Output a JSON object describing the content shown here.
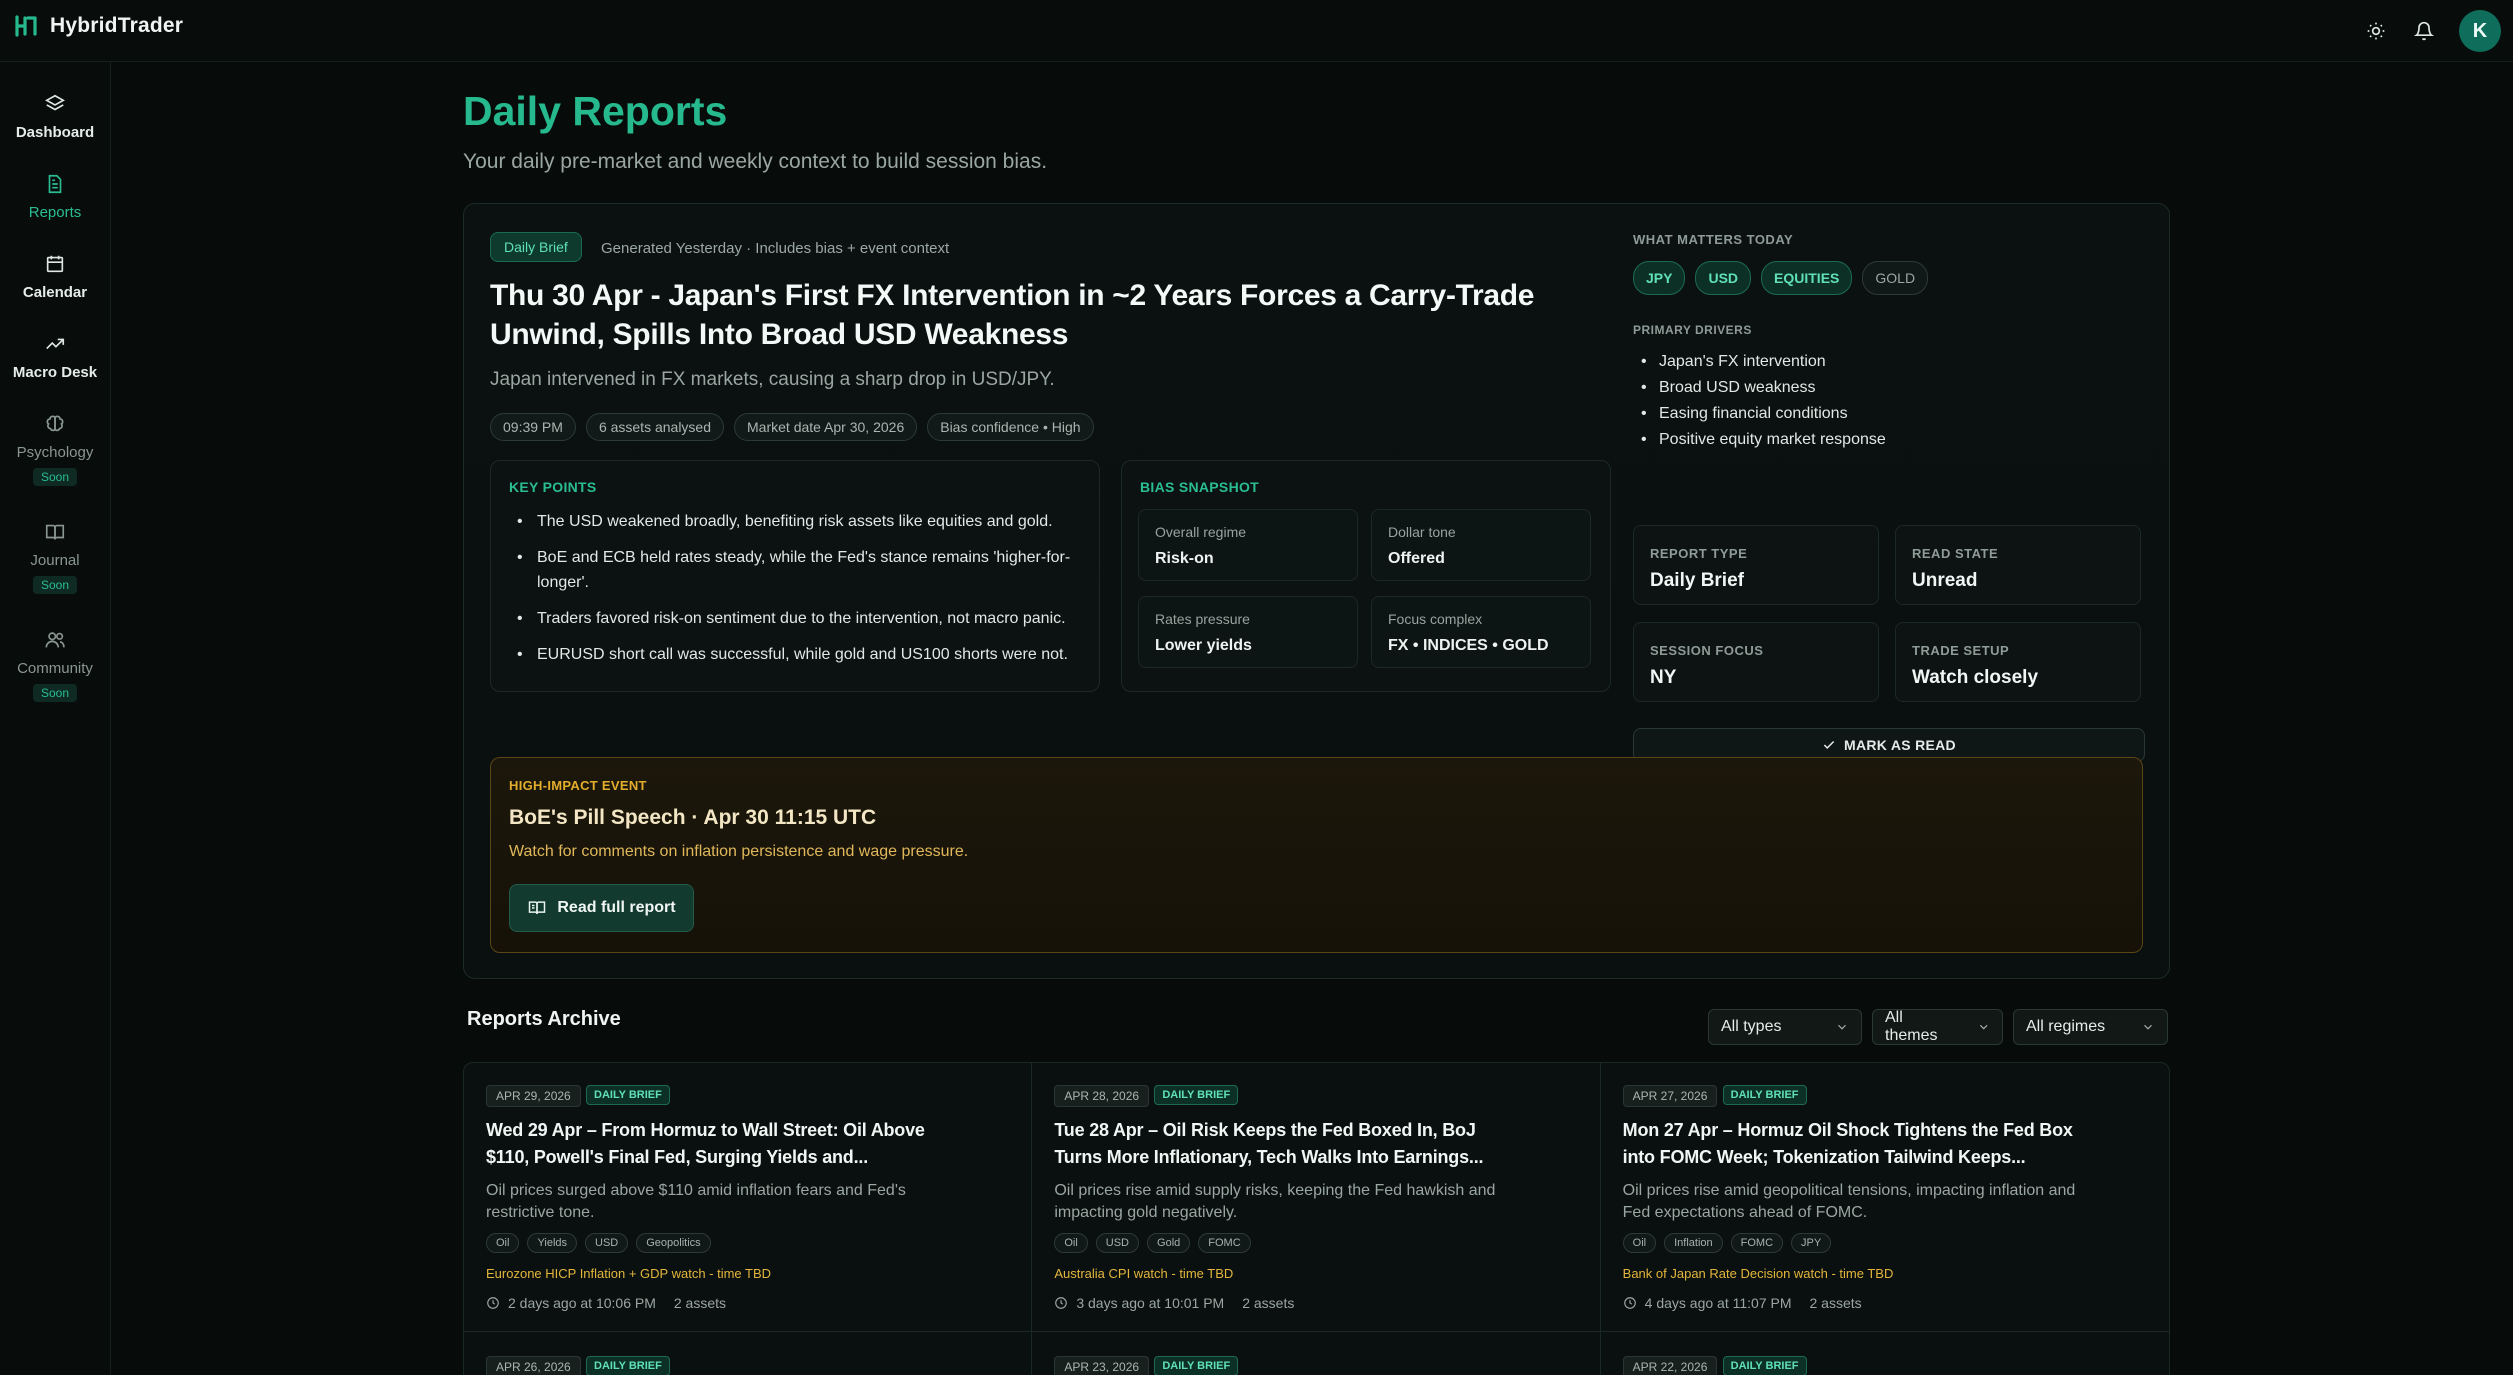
{
  "app": {
    "name": "HybridTrader",
    "avatar_letter": "K"
  },
  "icons": {
    "theme": "sun-icon",
    "notifications": "bell-icon"
  },
  "colors": {
    "accent": "#27b98e",
    "event": "#e3ad2c",
    "background": "#070c0b"
  },
  "sidebar": {
    "items": [
      {
        "label": "Dashboard",
        "icon": "layers-icon",
        "soon": ""
      },
      {
        "label": "Reports",
        "icon": "document-icon",
        "soon": "",
        "active": true
      },
      {
        "label": "Calendar",
        "icon": "calendar-icon",
        "soon": ""
      },
      {
        "label": "Macro Desk",
        "icon": "trending-up-icon",
        "soon": ""
      },
      {
        "label": "Psychology",
        "icon": "brain-icon",
        "soon": "Soon"
      },
      {
        "label": "Journal",
        "icon": "book-icon",
        "soon": "Soon"
      },
      {
        "label": "Community",
        "icon": "users-icon",
        "soon": "Soon"
      }
    ]
  },
  "page": {
    "title": "Daily Reports",
    "subtitle": "Your daily pre-market and weekly context to build session bias."
  },
  "report": {
    "type_badge": "Daily Brief",
    "generated": "Generated Yesterday · Includes bias + event context",
    "headline": "Thu 30 Apr - Japan's First FX Intervention in ~2 Years Forces a Carry-Trade Unwind, Spills Into Broad USD Weakness",
    "summary": "Japan intervened in FX markets, causing a sharp drop in USD/JPY.",
    "meta": [
      "09:39 PM",
      "6 assets analysed",
      "Market date Apr 30, 2026",
      "Bias confidence • High"
    ],
    "key_points_label": "KEY POINTS",
    "key_points": [
      "The USD weakened broadly, benefiting risk assets like equities and gold.",
      "BoE and ECB held rates steady, while the Fed's stance remains 'higher-for-longer'.",
      "Traders favored risk-on sentiment due to the intervention, not macro panic.",
      "EURUSD short call was successful, while gold and US100 shorts were not."
    ],
    "bias_label": "BIAS SNAPSHOT",
    "bias": [
      {
        "label": "Overall regime",
        "value": "Risk-on"
      },
      {
        "label": "Dollar tone",
        "value": "Offered"
      },
      {
        "label": "Rates pressure",
        "value": "Lower yields"
      },
      {
        "label": "Focus complex",
        "value": "FX • INDICES • GOLD"
      }
    ],
    "what_matters_label": "WHAT MATTERS TODAY",
    "what_matters": [
      {
        "label": "JPY",
        "highlight": true
      },
      {
        "label": "USD",
        "highlight": true
      },
      {
        "label": "EQUITIES",
        "highlight": true
      },
      {
        "label": "GOLD",
        "highlight": false
      }
    ],
    "drivers_label": "PRIMARY DRIVERS",
    "drivers": [
      "Japan's FX intervention",
      "Broad USD weakness",
      "Easing financial conditions",
      "Positive equity market response"
    ],
    "info": [
      {
        "label": "REPORT TYPE",
        "value": "Daily Brief"
      },
      {
        "label": "READ STATE",
        "value": "Unread"
      },
      {
        "label": "SESSION FOCUS",
        "value": "NY"
      },
      {
        "label": "TRADE SETUP",
        "value": "Watch closely"
      }
    ],
    "mark_read": "MARK AS READ",
    "event": {
      "label": "HIGH-IMPACT EVENT",
      "title": "BoE's Pill Speech · Apr 30 11:15 UTC",
      "desc": "Watch for comments on inflation persistence and wage pressure.",
      "button": "Read full report"
    }
  },
  "archive": {
    "title": "Reports Archive",
    "filters": [
      "All types",
      "All themes",
      "All regimes"
    ],
    "cards": [
      {
        "date": "APR 29, 2026",
        "type": "DAILY BRIEF",
        "title": "Wed 29 Apr – From Hormuz to Wall Street: Oil Above $110, Powell's Final Fed, Surging Yields and...",
        "summary": "Oil prices surged above $110 amid inflation fears and Fed's restrictive tone.",
        "tags": [
          "Oil",
          "Yields",
          "USD",
          "Geopolitics"
        ],
        "watch": "Eurozone HICP Inflation + GDP watch - time TBD",
        "time": "2 days ago at 10:06 PM",
        "assets": "2 assets",
        "next_date": "APR 26, 2026",
        "next_type": "DAILY BRIEF"
      },
      {
        "date": "APR 28, 2026",
        "type": "DAILY BRIEF",
        "title": "Tue 28 Apr – Oil Risk Keeps the Fed Boxed In, BoJ Turns More Inflationary, Tech Walks Into Earnings...",
        "summary": "Oil prices rise amid supply risks, keeping the Fed hawkish and impacting gold negatively.",
        "tags": [
          "Oil",
          "USD",
          "Gold",
          "FOMC"
        ],
        "watch": "Australia CPI watch - time TBD",
        "time": "3 days ago at 10:01 PM",
        "assets": "2 assets",
        "next_date": "APR 23, 2026",
        "next_type": "DAILY BRIEF"
      },
      {
        "date": "APR 27, 2026",
        "type": "DAILY BRIEF",
        "title": "Mon 27 Apr – Hormuz Oil Shock Tightens the Fed Box into FOMC Week; Tokenization Tailwind Keeps...",
        "summary": "Oil prices rise amid geopolitical tensions, impacting inflation and Fed expectations ahead of FOMC.",
        "tags": [
          "Oil",
          "Inflation",
          "FOMC",
          "JPY"
        ],
        "watch": "Bank of Japan Rate Decision watch - time TBD",
        "time": "4 days ago at 11:07 PM",
        "assets": "2 assets",
        "next_date": "APR 22, 2026",
        "next_type": "DAILY BRIEF"
      }
    ]
  }
}
